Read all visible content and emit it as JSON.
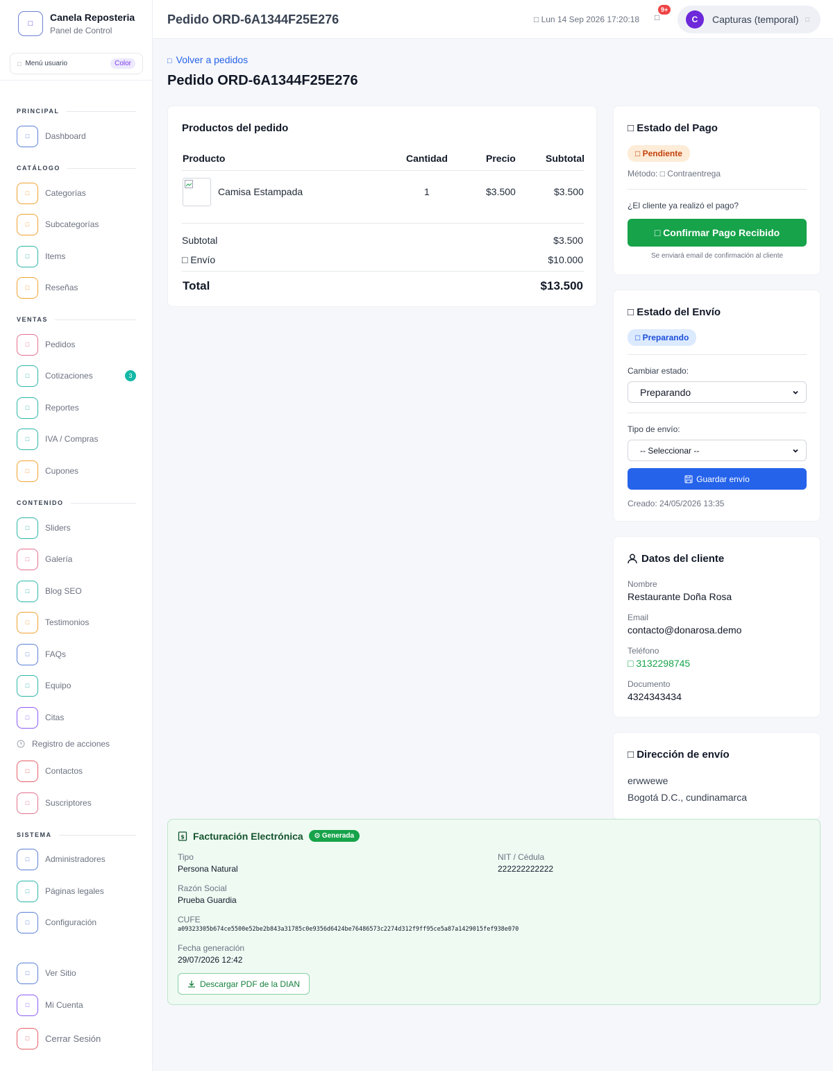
{
  "brand": {
    "name": "Canela Reposteria",
    "subtitle": "Panel de Control",
    "logo_icon": "□"
  },
  "user_menu": {
    "label": "Menú usuario",
    "badge": "Color",
    "icon": "□"
  },
  "nav": {
    "sections": {
      "principal": "PRINCIPAL",
      "catalogo": "CATÁLOGO",
      "ventas": "VENTAS",
      "contenido": "CONTENIDO",
      "sistema": "SISTEMA"
    },
    "icon_glyph": "□",
    "items": {
      "dashboard": "Dashboard",
      "categorias": "Categorías",
      "subcategorias": "Subcategorías",
      "items": "Items",
      "resenas": "Reseñas",
      "pedidos": "Pedidos",
      "cotizaciones": "Cotizaciones",
      "cotizaciones_count": "3",
      "reportes": "Reportes",
      "iva": "IVA / Compras",
      "cupones": "Cupones",
      "sliders": "Sliders",
      "galeria": "Galería",
      "blog": "Blog SEO",
      "testimonios": "Testimonios",
      "faqs": "FAQs",
      "equipo": "Equipo",
      "citas": "Citas",
      "registro": "Registro de acciones",
      "contactos": "Contactos",
      "suscriptores": "Suscriptores",
      "administradores": "Administradores",
      "paginas": "Páginas legales",
      "configuracion": "Configuración",
      "ver_sitio": "Ver Sitio",
      "mi_cuenta": "Mi Cuenta",
      "cerrar": "Cerrar Sesión"
    },
    "colors": {
      "blue": "#5b7fd6",
      "orange": "#f0a233",
      "teal": "#2cb5a8",
      "pink": "#e4708f",
      "purple": "#8b5cf6",
      "red": "#e4606a"
    }
  },
  "topbar": {
    "title": "Pedido ORD-6A1344F25E276",
    "date": "□ Lun 14 Sep 2026 17:20:18",
    "bell_icon": "□",
    "notif_count": "9+",
    "user_initial": "C",
    "user_name": "Capturas (temporal)",
    "caret_icon": "□"
  },
  "page": {
    "back_icon": "□",
    "back_label": "Volver a pedidos",
    "title": "Pedido ORD-6A1344F25E276"
  },
  "products": {
    "title": "Productos del pedido",
    "headers": {
      "product": "Producto",
      "qty": "Cantidad",
      "price": "Precio",
      "subtotal": "Subtotal"
    },
    "rows": [
      {
        "name": "Camisa Estampada",
        "qty": "1",
        "price": "$3.500",
        "subtotal": "$3.500"
      }
    ],
    "subtotal_label": "Subtotal",
    "subtotal_value": "$3.500",
    "shipping_label": "□ Envío",
    "shipping_value": "$10.000",
    "total_label": "Total",
    "total_value": "$13.500"
  },
  "payment": {
    "title": "□ Estado del Pago",
    "status": "□ Pendiente",
    "method": "Método: □ Contraentrega",
    "question": "¿El cliente ya realizó el pago?",
    "confirm_button": "□ Confirmar Pago Recibido",
    "note": "Se enviará email de confirmación al cliente",
    "colors": {
      "pending_bg": "#fdecd7",
      "pending_fg": "#c2410c",
      "confirm": "#16a34a"
    }
  },
  "shipping": {
    "title": "□ Estado del Envío",
    "status": "□ Preparando",
    "change_label": "Cambiar estado:",
    "status_value": "Preparando",
    "type_label": "Tipo de envío:",
    "type_value": "-- Seleccionar --",
    "save_button": "Guardar envío",
    "created": "Creado: 24/05/2026 13:35",
    "colors": {
      "status_bg": "#dbeafe",
      "status_fg": "#1d4ed8",
      "save": "#2563eb"
    }
  },
  "client": {
    "title": "Datos del cliente",
    "icon": "user-icon",
    "name_label": "Nombre",
    "name": "Restaurante Doña Rosa",
    "email_label": "Email",
    "email": "contacto@donarosa.demo",
    "phone_label": "Teléfono",
    "phone": "□ 3132298745",
    "doc_label": "Documento",
    "doc": "4324343434",
    "colors": {
      "phone": "#16a34a"
    }
  },
  "address": {
    "title": "□ Dirección de envío",
    "line1": "erwwewe",
    "line2": "Bogotá D.C., cundinamarca"
  },
  "invoice": {
    "title": "Facturación Electrónica",
    "badge": "Generada",
    "type_label": "Tipo",
    "type": "Persona Natural",
    "nit_label": "NIT / Cédula",
    "nit": "222222222222",
    "company_label": "Razón Social",
    "company": "Prueba Guardia",
    "cufe_label": "CUFE",
    "cufe": "a09323305b674ce5500e52be2b843a31785c0e9356d6424be76486573c2274d312f9ff95ce5a87a1429015fef938e070",
    "date_label": "Fecha generación",
    "date": "29/07/2026 12:42",
    "download_button": "Descargar PDF de la DIAN",
    "colors": {
      "bg": "#effaf3",
      "border": "#bbe5c9",
      "badge": "#16a34a"
    }
  }
}
